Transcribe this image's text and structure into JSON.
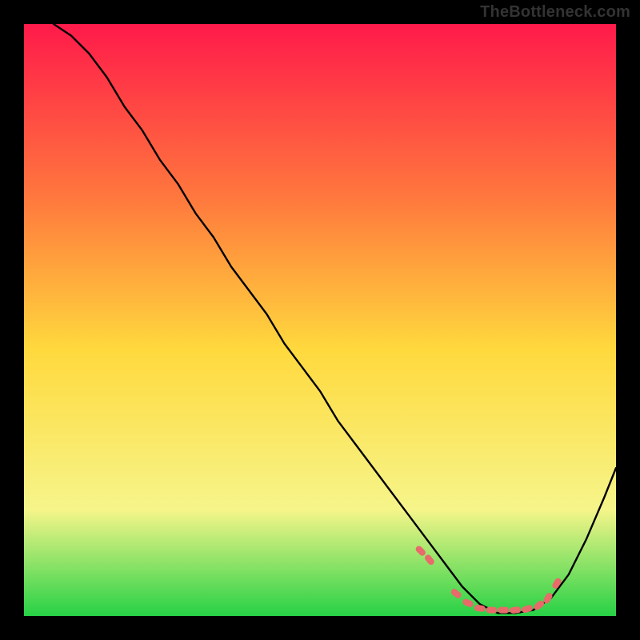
{
  "watermark": "TheBottleneck.com",
  "colors": {
    "background": "#000000",
    "gradient_top": "#ff1a4a",
    "gradient_mid_upper": "#ff7a3d",
    "gradient_mid": "#ffd93d",
    "gradient_lower": "#f6f58a",
    "gradient_bottom": "#27d146",
    "curve": "#000000",
    "marker": "#e86a6a",
    "watermark": "#333333"
  },
  "chart_data": {
    "type": "line",
    "title": "",
    "xlabel": "",
    "ylabel": "",
    "xlim": [
      0,
      100
    ],
    "ylim": [
      0,
      100
    ],
    "series": [
      {
        "name": "bottleneck-curve",
        "x": [
          5,
          8,
          11,
          14,
          17,
          20,
          23,
          26,
          29,
          32,
          35,
          38,
          41,
          44,
          47,
          50,
          53,
          56,
          59,
          62,
          65,
          68,
          71,
          74,
          77,
          80,
          83,
          86,
          89,
          92,
          95,
          98,
          100
        ],
        "y": [
          100,
          98,
          95,
          91,
          86,
          82,
          77,
          73,
          68,
          64,
          59,
          55,
          51,
          46,
          42,
          38,
          33,
          29,
          25,
          21,
          17,
          13,
          9,
          5,
          2,
          0.5,
          0.5,
          1,
          3,
          7,
          13,
          20,
          25
        ]
      }
    ],
    "markers": {
      "name": "highlight-dots",
      "x": [
        67,
        68.5,
        73,
        75,
        77,
        79,
        81,
        83,
        85,
        87,
        88.5,
        90
      ],
      "y": [
        11,
        9.5,
        3.8,
        2.2,
        1.3,
        1,
        1,
        1,
        1.2,
        1.8,
        3,
        5.5
      ]
    }
  }
}
